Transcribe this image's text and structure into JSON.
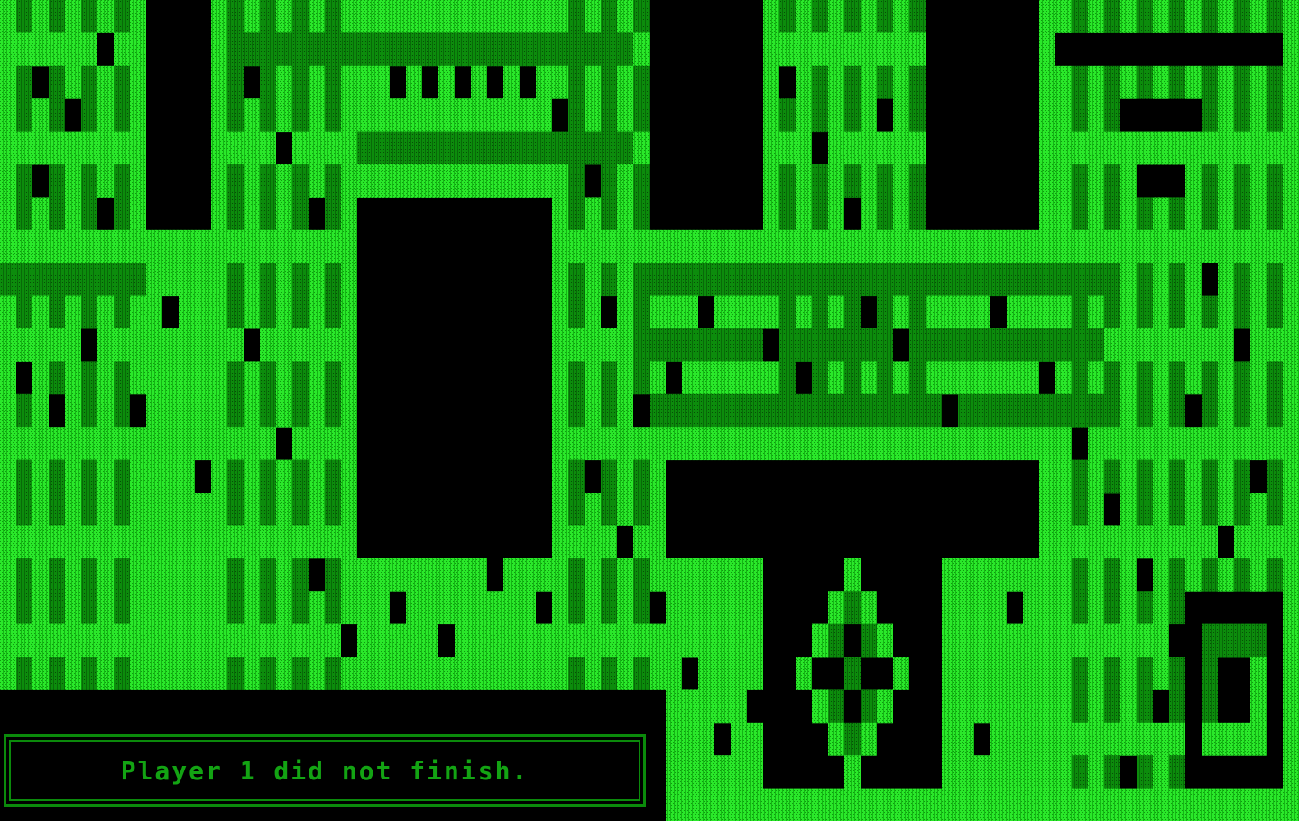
{
  "game": {
    "status_message": "Player 1 did not finish."
  },
  "colors": {
    "background": "#000000",
    "bright_wall": "#22e622",
    "dark_wall": "#0b8a0b",
    "status_text": "#13a313"
  },
  "icons": {
    "wall_tile": "dithered-green-block"
  }
}
